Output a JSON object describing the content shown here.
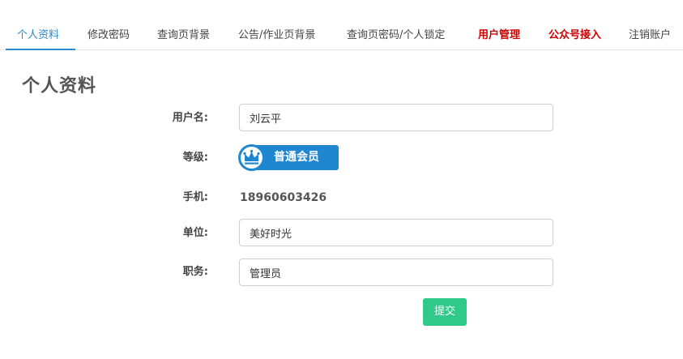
{
  "tabs": [
    {
      "label": "个人资料"
    },
    {
      "label": "修改密码"
    },
    {
      "label": "查询页背景"
    },
    {
      "label": "公告/作业页背景"
    },
    {
      "label": "查询页密码/个人锁定"
    },
    {
      "label": "用户管理"
    },
    {
      "label": "公众号接入"
    },
    {
      "label": "注销账户"
    }
  ],
  "page_title": "个人资料",
  "form": {
    "username_label": "用户名:",
    "username_value": "刘云平",
    "level_label": "等级:",
    "level_badge": "普通会员",
    "phone_label": "手机:",
    "phone_value": "18960603426",
    "unit_label": "单位:",
    "unit_value": "美好时光",
    "position_label": "职务:",
    "position_value": "管理员",
    "submit_label": "提交"
  },
  "colors": {
    "active_tab": "#2a8bd0",
    "highlight_tab": "#cc0000",
    "badge": "#1f86d0",
    "submit": "#2fc98a"
  },
  "icons": {
    "badge_icon": "crown-icon"
  }
}
